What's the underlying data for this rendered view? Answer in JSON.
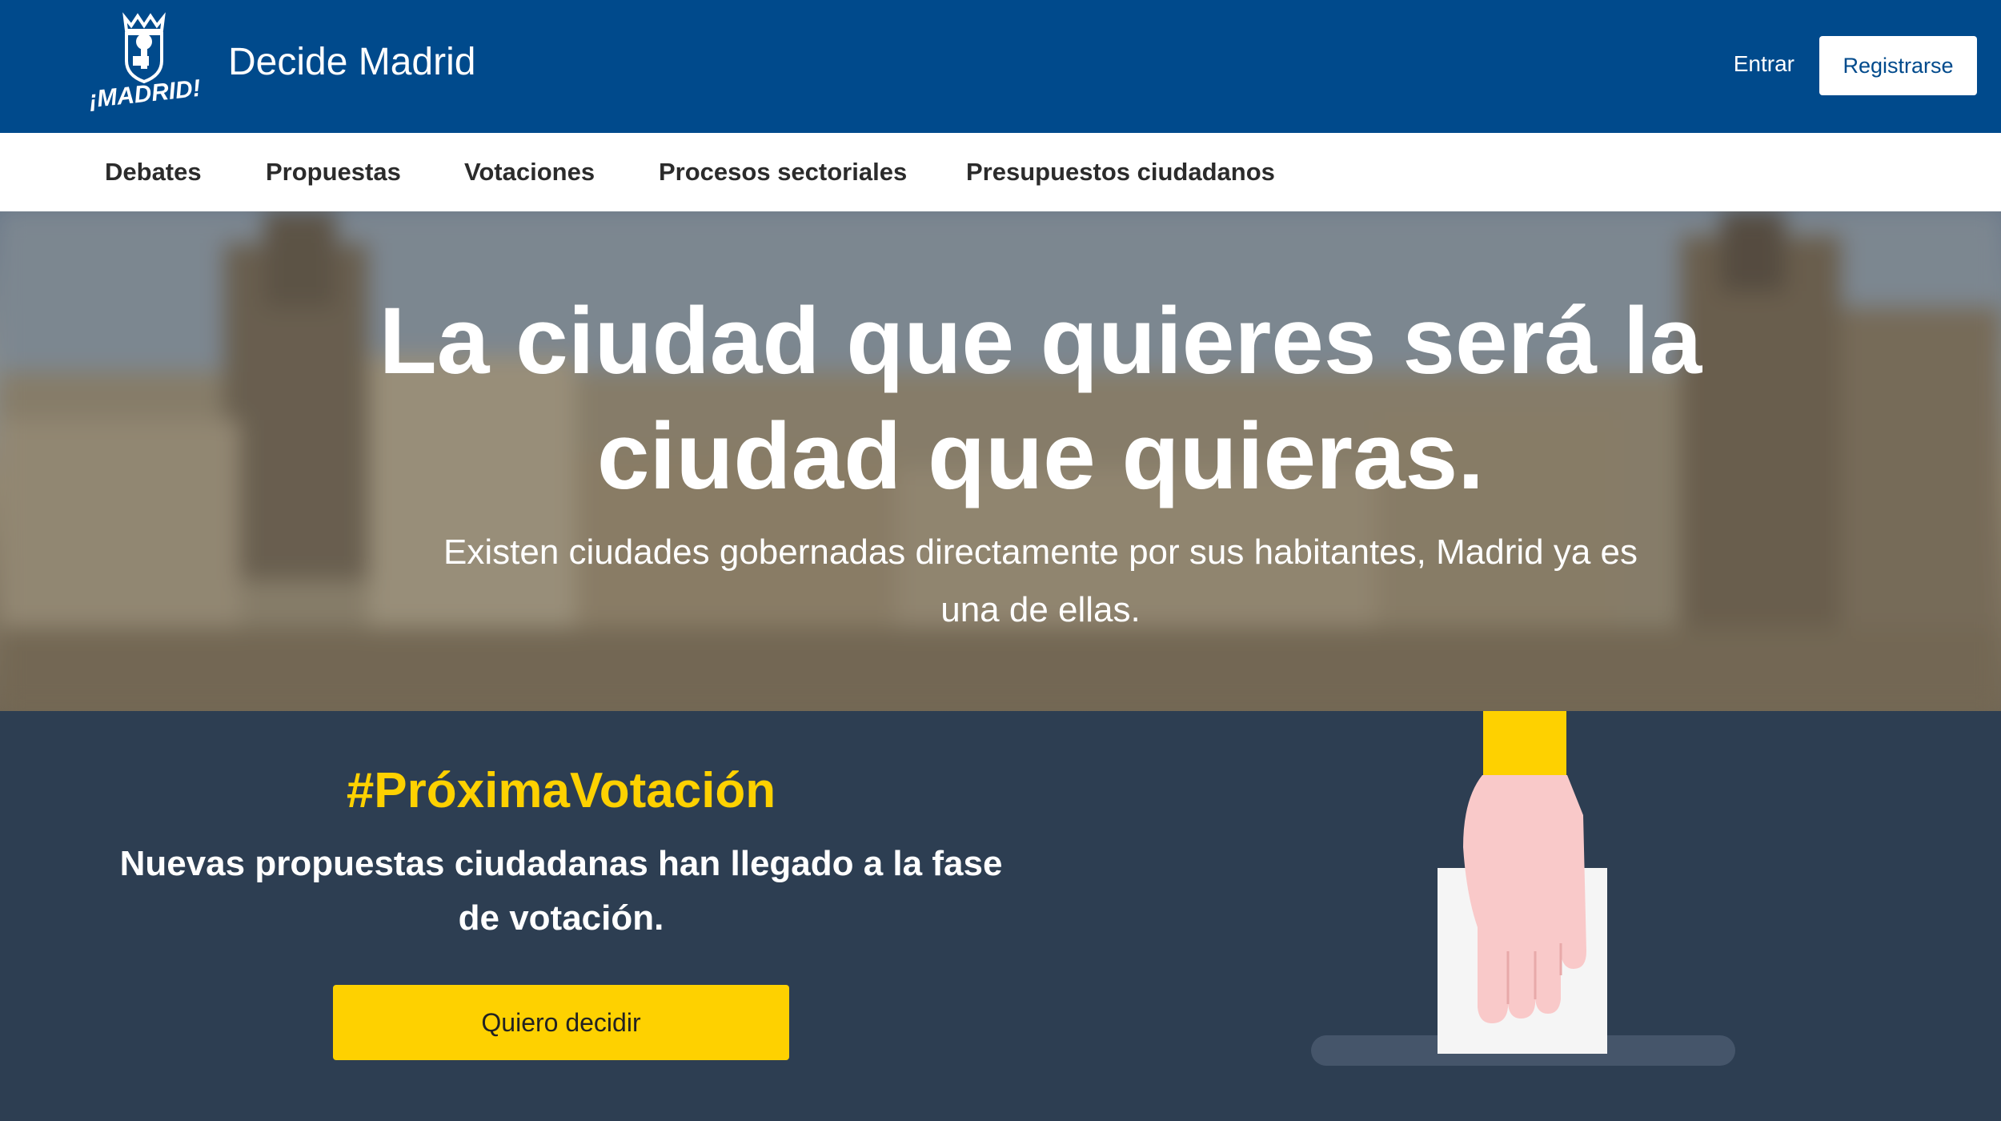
{
  "header": {
    "logo_text": "¡MADRID!",
    "site_title": "Decide Madrid",
    "login_label": "Entrar",
    "register_label": "Registrarse"
  },
  "nav": {
    "items": [
      {
        "label": "Debates"
      },
      {
        "label": "Propuestas"
      },
      {
        "label": "Votaciones"
      },
      {
        "label": "Procesos sectoriales"
      },
      {
        "label": "Presupuestos ciudadanos"
      }
    ]
  },
  "hero": {
    "title_line1": "La ciudad que quieres será la",
    "title_line2": "ciudad que quieras.",
    "subtitle_line1": "Existen ciudades gobernadas directamente por sus habitantes, Madrid ya es",
    "subtitle_line2": "una de ellas."
  },
  "promo": {
    "hashtag": "#PróximaVotación",
    "text_line1": "Nuevas propuestas ciudadanas han llegado a la fase",
    "text_line2": "de votación.",
    "cta_label": "Quiero decidir"
  },
  "colors": {
    "header_blue": "#004a8c",
    "promo_bg": "#2d3e52",
    "accent_yellow": "#fed100",
    "hand_pink": "#f9c9c9"
  }
}
